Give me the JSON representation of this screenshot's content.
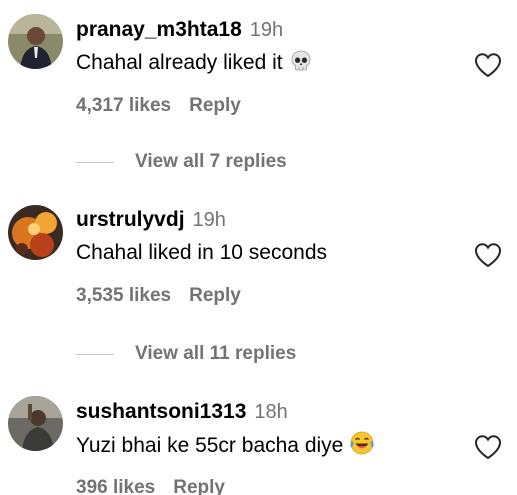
{
  "comments": [
    {
      "username": "pranay_m3hta18",
      "time": "19h",
      "text": "Chahal already liked it",
      "emoji": "skull",
      "likes": "4,317 likes",
      "reply_label": "Reply",
      "view_replies": "View all 7 replies"
    },
    {
      "username": "urstrulyvdj",
      "time": "19h",
      "text": "Chahal liked in 10 seconds",
      "emoji": "",
      "likes": "3,535 likes",
      "reply_label": "Reply",
      "view_replies": "View all 11 replies"
    },
    {
      "username": "sushantsoni1313",
      "time": "18h",
      "text": "Yuzi bhai ke 55cr bacha diye",
      "emoji": "face-with-tears-of-joy",
      "likes": "396 likes",
      "reply_label": "Reply"
    }
  ],
  "icons": {
    "like": "heart-outline-icon"
  },
  "colors": {
    "secondary_text": "#737373",
    "divider": "#c7c7c7",
    "primary_text": "#000000"
  }
}
